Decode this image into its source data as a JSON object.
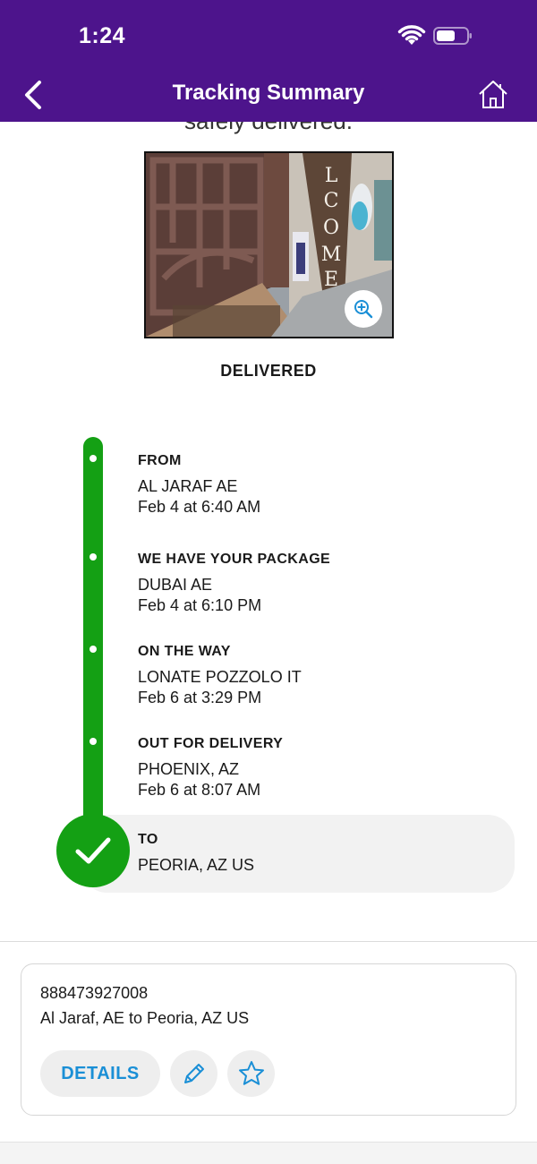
{
  "status_bar": {
    "time": "1:24"
  },
  "header": {
    "title": "Tracking Summary"
  },
  "hero": {
    "partial_message": "safely delivered.",
    "status": "DELIVERED"
  },
  "timeline": [
    {
      "title": "FROM",
      "location": "AL JARAF AE",
      "date": "Feb 4 at 6:40 AM"
    },
    {
      "title": "WE HAVE YOUR PACKAGE",
      "location": "DUBAI AE",
      "date": "Feb 4 at 6:10 PM"
    },
    {
      "title": "ON THE WAY",
      "location": "LONATE POZZOLO IT",
      "date": "Feb 6 at 3:29 PM"
    },
    {
      "title": "OUT FOR DELIVERY",
      "location": "PHOENIX, AZ",
      "date": "Feb 6 at 8:07 AM"
    },
    {
      "title": "TO",
      "location": "PEORIA, AZ  US"
    }
  ],
  "shipment": {
    "tracking_number": "888473927008",
    "route": "Al Jaraf, AE to Peoria, AZ US",
    "details_label": "DETAILS"
  },
  "colors": {
    "brand": "#4d148c",
    "success": "#14a014",
    "link": "#1a8fd6"
  },
  "icons": [
    "wifi-icon",
    "battery-icon",
    "back-chevron-icon",
    "home-icon",
    "zoom-in-icon",
    "checkmark-icon",
    "pencil-icon",
    "star-icon"
  ]
}
